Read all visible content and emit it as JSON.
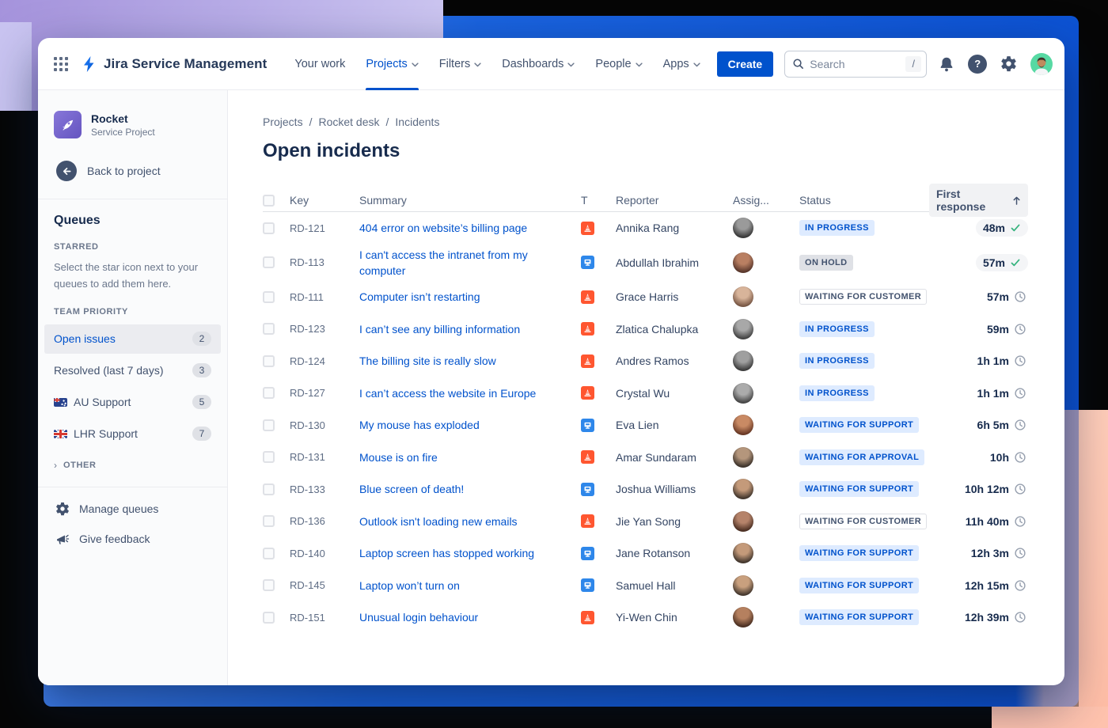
{
  "colors": {
    "accent_blue": "#0052CC",
    "incident_icon": "#FF5630",
    "it_help_icon": "#2E87EA",
    "status_blue_bg": "#DEEBFF",
    "status_gray_bg": "#DFE1E6",
    "check_green": "#36B37E",
    "backdrop_blue": "#0A4FD1",
    "backdrop_purple": "#A593DC",
    "backdrop_salmon": "#FFC3AE",
    "avatar_green": "#57D9A3"
  },
  "nav": {
    "logo_text": "Jira Service Management",
    "items": [
      {
        "label": "Your work",
        "caret": false,
        "active": false
      },
      {
        "label": "Projects",
        "caret": true,
        "active": true
      },
      {
        "label": "Filters",
        "caret": true,
        "active": false
      },
      {
        "label": "Dashboards",
        "caret": true,
        "active": false
      },
      {
        "label": "People",
        "caret": true,
        "active": false
      },
      {
        "label": "Apps",
        "caret": true,
        "active": false
      }
    ],
    "create_label": "Create",
    "search": {
      "placeholder": "Search",
      "shortcut": "/"
    },
    "help_glyph": "?"
  },
  "sidebar": {
    "project": {
      "name": "Rocket",
      "type": "Service Project"
    },
    "back_label": "Back to project",
    "queues_title": "Queues",
    "starred_label": "STARRED",
    "starred_hint": "Select the star icon next to your queues to add them here.",
    "team_priority_label": "TEAM PRIORITY",
    "queues": [
      {
        "label": "Open issues",
        "count": "2",
        "selected": true,
        "flag": null
      },
      {
        "label": "Resolved (last 7 days)",
        "count": "3",
        "selected": false,
        "flag": null
      },
      {
        "label": "AU Support",
        "count": "5",
        "selected": false,
        "flag": "au"
      },
      {
        "label": "LHR Support",
        "count": "7",
        "selected": false,
        "flag": "gb"
      }
    ],
    "other_chevron": "›",
    "other_label": "OTHER",
    "manage_label": "Manage queues",
    "feedback_label": "Give feedback"
  },
  "main": {
    "breadcrumb": {
      "0": "Projects",
      "1": "Rocket desk",
      "2": "Incidents"
    },
    "title": "Open incidents",
    "table": {
      "headers": {
        "key": "Key",
        "summary": "Summary",
        "type": "T",
        "reporter": "Reporter",
        "assignee": "Assig...",
        "status": "Status",
        "first_response": "First response"
      },
      "sort_column": "First response",
      "sort_direction": "asc",
      "rows": [
        {
          "key": "RD-121",
          "summary": "404 error on website’s billing page",
          "type": "incident",
          "reporter": "Annika Rang",
          "status": "IN PROGRESS",
          "badge": "blue",
          "response": "48m",
          "response_state": "done",
          "avatar": [
            "#9a9a9a",
            "#3c3c3c"
          ]
        },
        {
          "key": "RD-113",
          "summary": "I can't access the intranet from my computer",
          "type": "it-help",
          "reporter": "Abdullah Ibrahim",
          "status": "ON HOLD",
          "badge": "gray",
          "response": "57m",
          "response_state": "done",
          "avatar": [
            "#b97f62",
            "#5d3a2e"
          ]
        },
        {
          "key": "RD-111",
          "summary": "Computer isn’t restarting",
          "type": "incident",
          "reporter": "Grace Harris",
          "status": "WAITING FOR CUSTOMER",
          "badge": "outline",
          "response": "57m",
          "response_state": "pending",
          "avatar": [
            "#d8b49a",
            "#7d5b48"
          ]
        },
        {
          "key": "RD-123",
          "summary": "I can’t see any billing information",
          "type": "incident",
          "reporter": "Zlatica Chalupka",
          "status": "IN PROGRESS",
          "badge": "blue",
          "response": "59m",
          "response_state": "pending",
          "avatar": [
            "#a8a8a8",
            "#474747"
          ]
        },
        {
          "key": "RD-124",
          "summary": "The billing site is really slow",
          "type": "incident",
          "reporter": "Andres Ramos",
          "status": "IN PROGRESS",
          "badge": "blue",
          "response": "1h 1m",
          "response_state": "pending",
          "avatar": [
            "#9f9f9f",
            "#404040"
          ]
        },
        {
          "key": "RD-127",
          "summary": "I can’t access the website in Europe",
          "type": "incident",
          "reporter": "Crystal Wu",
          "status": "IN PROGRESS",
          "badge": "blue",
          "response": "1h 1m",
          "response_state": "pending",
          "avatar": [
            "#ababab",
            "#4a4a4a"
          ]
        },
        {
          "key": "RD-130",
          "summary": "My mouse has exploded",
          "type": "it-help",
          "reporter": "Eva Lien",
          "status": "WAITING FOR SUPPORT",
          "badge": "blue",
          "response": "6h 5m",
          "response_state": "pending",
          "avatar": [
            "#c98a64",
            "#6e3c28"
          ]
        },
        {
          "key": "RD-131",
          "summary": "Mouse is on fire",
          "type": "incident",
          "reporter": "Amar Sundaram",
          "status": "WAITING FOR APPROVAL",
          "badge": "blue",
          "response": "10h",
          "response_state": "pending",
          "avatar": [
            "#b4967c",
            "#42372e"
          ]
        },
        {
          "key": "RD-133",
          "summary": "Blue screen of death!",
          "type": "it-help",
          "reporter": "Joshua Williams",
          "status": "WAITING FOR SUPPORT",
          "badge": "blue",
          "response": "10h 12m",
          "response_state": "pending",
          "avatar": [
            "#c49a7a",
            "#473a30"
          ]
        },
        {
          "key": "RD-136",
          "summary": "Outlook isn't loading new emails",
          "type": "incident",
          "reporter": "Jie Yan Song",
          "status": "WAITING FOR CUSTOMER",
          "badge": "outline",
          "response": "11h 40m",
          "response_state": "pending",
          "avatar": [
            "#b5836a",
            "#503326"
          ]
        },
        {
          "key": "RD-140",
          "summary": "Laptop screen has stopped working",
          "type": "it-help",
          "reporter": "Jane Rotanson",
          "status": "WAITING FOR SUPPORT",
          "badge": "blue",
          "response": "12h 3m",
          "response_state": "pending",
          "avatar": [
            "#c49a7a",
            "#473a30"
          ]
        },
        {
          "key": "RD-145",
          "summary": "Laptop won’t turn on",
          "type": "it-help",
          "reporter": "Samuel Hall",
          "status": "WAITING FOR SUPPORT",
          "badge": "blue",
          "response": "12h 15m",
          "response_state": "pending",
          "avatar": [
            "#c9a07e",
            "#4a3c31"
          ]
        },
        {
          "key": "RD-151",
          "summary": "Unusual login behaviour",
          "type": "incident",
          "reporter": "Yi-Wen Chin",
          "status": "WAITING FOR SUPPORT",
          "badge": "blue",
          "response": "12h 39m",
          "response_state": "pending",
          "avatar": [
            "#b5805f",
            "#4f3224"
          ]
        }
      ]
    }
  }
}
